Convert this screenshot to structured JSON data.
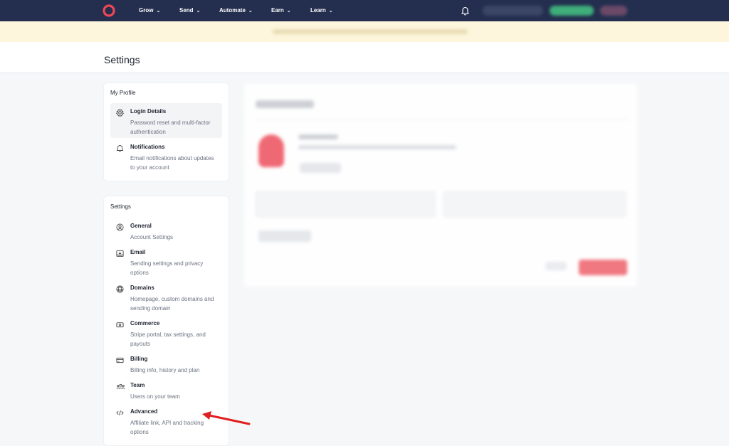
{
  "topnav": {
    "items": [
      {
        "label": "Grow"
      },
      {
        "label": "Send"
      },
      {
        "label": "Automate"
      },
      {
        "label": "Earn"
      },
      {
        "label": "Learn"
      }
    ]
  },
  "page": {
    "title": "Settings"
  },
  "profile": {
    "heading": "My Profile",
    "items": [
      {
        "title": "Login Details",
        "desc": "Password reset and multi-factor authentication",
        "icon": "gear-icon"
      },
      {
        "title": "Notifications",
        "desc": "Email notifications about updates to your account",
        "icon": "bell-icon"
      }
    ]
  },
  "settings": {
    "heading": "Settings",
    "items": [
      {
        "title": "General",
        "desc": "Account Settings",
        "icon": "user-circle-icon"
      },
      {
        "title": "Email",
        "desc": "Sending settings and privacy options",
        "icon": "inbox-download-icon"
      },
      {
        "title": "Domains",
        "desc": "Homepage, custom domains and sending domain",
        "icon": "globe-icon"
      },
      {
        "title": "Commerce",
        "desc": "Stripe portal, tax settings, and payouts",
        "icon": "money-icon"
      },
      {
        "title": "Billing",
        "desc": "Billing info, history and plan",
        "icon": "credit-card-icon"
      },
      {
        "title": "Team",
        "desc": "Users on your team",
        "icon": "team-icon"
      },
      {
        "title": "Advanced",
        "desc": "Affiliate link, API and tracking options",
        "icon": "code-icon"
      }
    ]
  },
  "colors": {
    "nav": "#242f4f",
    "brand_red": "#e8414f",
    "annotation_arrow": "#e02020"
  }
}
